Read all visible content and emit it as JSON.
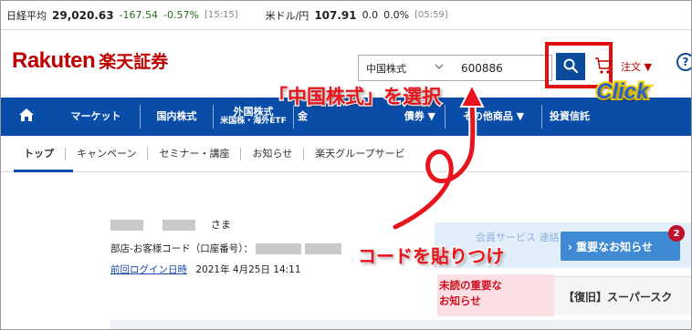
{
  "ticker": {
    "nikkei_label": "日経平均",
    "nikkei_value": "29,020.63",
    "nikkei_change": "-167.54",
    "nikkei_pct": "-0.57%",
    "nikkei_time": "[15:15]",
    "usdjpy_label": "米ドル/円",
    "usdjpy_value": "107.91",
    "usdjpy_change": "0.0",
    "usdjpy_pct": "0.0%",
    "usdjpy_time": "[05:59]"
  },
  "header": {
    "logo_en": "Rakuten",
    "logo_jp": "楽天証券",
    "market_select": "中国株式",
    "code_value": "600886",
    "order_label": "注文 ▼",
    "help_label": "?"
  },
  "nav": {
    "items": [
      {
        "label": "マーケット",
        "sub": ""
      },
      {
        "label": "国内株式",
        "sub": ""
      },
      {
        "label": "外国株式",
        "sub": "米国株・海外ETF"
      },
      {
        "label": "金",
        "sub": ""
      },
      {
        "label": "債券 ▼",
        "sub": ""
      },
      {
        "label": "その他商品 ▼",
        "sub": ""
      },
      {
        "label": "投資信託",
        "sub": ""
      }
    ]
  },
  "subnav": {
    "items": [
      "トップ",
      "キャンペーン",
      "セミナー・講座",
      "お知らせ",
      "楽天グループサービ"
    ]
  },
  "user": {
    "sama": "さま",
    "code_label": "部店-お客様コード（口座番号）：",
    "login_link": "前回ログイン日時",
    "login_date": "2021年 4月25日 14:11"
  },
  "notices": {
    "faded_text": "会員サービス 連絡",
    "important_button": "› 重要なお知らせ",
    "badge_count": "2",
    "unread_line1": "未読の重要な",
    "unread_line2": "お知らせ",
    "recover_text": "【復旧】スーパースク"
  },
  "annotations": {
    "select_china": "「中国株式」を選択",
    "click": "Click",
    "paste_code": "コードを貼りつけ"
  },
  "colors": {
    "brand_red": "#bf0000",
    "nav_blue": "#0a4da8",
    "annotation_red": "#e8141c"
  }
}
